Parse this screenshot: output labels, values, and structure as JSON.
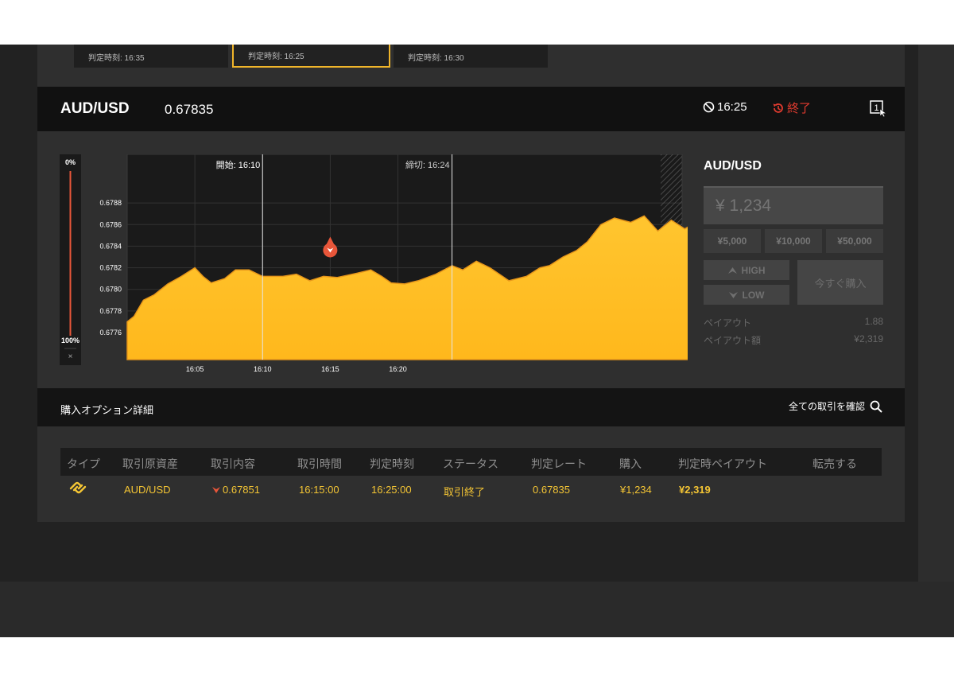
{
  "expiry_cards": [
    {
      "label": "判定時刻: 16:35"
    },
    {
      "label": "判定時刻: 16:25"
    },
    {
      "label": "判定時刻: 16:30"
    }
  ],
  "header": {
    "asset": "AUD/USD",
    "rate": "0.67835",
    "expiry": "16:25",
    "status": "終了",
    "screen_select_number": "1"
  },
  "chart_data": {
    "type": "area",
    "x_ticks": [
      "16:05",
      "16:10",
      "16:15",
      "16:20"
    ],
    "y_ticks": [
      "0.6788",
      "0.6786",
      "0.6784",
      "0.6782",
      "0.6780",
      "0.6778",
      "0.6776"
    ],
    "y_range": [
      0.67735,
      0.67925
    ],
    "x_range_minutes": [
      16.0,
      16.41
    ],
    "start_label": "開始: 16:10",
    "close_label": "締切: 16:24",
    "sentiment_top": "0%",
    "sentiment_bottom": "100%",
    "sentiment_close": "×",
    "entry": {
      "time": "16:15",
      "rate": 0.67851,
      "direction": "low"
    },
    "series": [
      {
        "t": 16.0,
        "v": 0.6777
      },
      {
        "t": 16.005,
        "v": 0.67775
      },
      {
        "t": 16.012,
        "v": 0.6779
      },
      {
        "t": 16.02,
        "v": 0.67795
      },
      {
        "t": 16.03,
        "v": 0.67805
      },
      {
        "t": 16.04,
        "v": 0.67812
      },
      {
        "t": 16.05,
        "v": 0.6782
      },
      {
        "t": 16.056,
        "v": 0.67812
      },
      {
        "t": 16.062,
        "v": 0.67806
      },
      {
        "t": 16.072,
        "v": 0.6781
      },
      {
        "t": 16.08,
        "v": 0.67818
      },
      {
        "t": 16.09,
        "v": 0.67818
      },
      {
        "t": 16.1,
        "v": 0.67812
      },
      {
        "t": 16.115,
        "v": 0.67812
      },
      {
        "t": 16.125,
        "v": 0.67814
      },
      {
        "t": 16.135,
        "v": 0.67808
      },
      {
        "t": 16.145,
        "v": 0.67812
      },
      {
        "t": 16.155,
        "v": 0.67811
      },
      {
        "t": 16.17,
        "v": 0.67815
      },
      {
        "t": 16.18,
        "v": 0.67818
      },
      {
        "t": 16.188,
        "v": 0.67812
      },
      {
        "t": 16.195,
        "v": 0.67806
      },
      {
        "t": 16.205,
        "v": 0.67805
      },
      {
        "t": 16.215,
        "v": 0.67808
      },
      {
        "t": 16.228,
        "v": 0.67814
      },
      {
        "t": 16.24,
        "v": 0.67822
      },
      {
        "t": 16.248,
        "v": 0.67818
      },
      {
        "t": 16.258,
        "v": 0.67826
      },
      {
        "t": 16.268,
        "v": 0.6782
      },
      {
        "t": 16.282,
        "v": 0.67808
      },
      {
        "t": 16.295,
        "v": 0.67812
      },
      {
        "t": 16.305,
        "v": 0.6782
      },
      {
        "t": 16.312,
        "v": 0.67822
      },
      {
        "t": 16.322,
        "v": 0.6783
      },
      {
        "t": 16.332,
        "v": 0.67836
      },
      {
        "t": 16.34,
        "v": 0.67844
      },
      {
        "t": 16.35,
        "v": 0.6786
      },
      {
        "t": 16.36,
        "v": 0.67866
      },
      {
        "t": 16.372,
        "v": 0.67862
      },
      {
        "t": 16.382,
        "v": 0.67868
      },
      {
        "t": 16.392,
        "v": 0.67854
      },
      {
        "t": 16.402,
        "v": 0.67864
      },
      {
        "t": 16.412,
        "v": 0.67856
      },
      {
        "t": 16.42,
        "v": 0.67862
      },
      {
        "t": 16.43,
        "v": 0.67853
      },
      {
        "t": 16.445,
        "v": 0.67856
      },
      {
        "t": 16.458,
        "v": 0.67854
      },
      {
        "t": 16.47,
        "v": 0.67858
      },
      {
        "t": 16.48,
        "v": 0.67867
      },
      {
        "t": 16.492,
        "v": 0.67868
      },
      {
        "t": 16.505,
        "v": 0.67854
      },
      {
        "t": 16.515,
        "v": 0.67842
      },
      {
        "t": 16.522,
        "v": 0.67832
      },
      {
        "t": 16.535,
        "v": 0.67828
      },
      {
        "t": 16.548,
        "v": 0.67828
      },
      {
        "t": 16.56,
        "v": 0.67834
      },
      {
        "t": 16.57,
        "v": 0.67836
      },
      {
        "t": 16.58,
        "v": 0.67833
      },
      {
        "t": 16.592,
        "v": 0.67828
      },
      {
        "t": 16.605,
        "v": 0.67828
      },
      {
        "t": 16.62,
        "v": 0.67831
      },
      {
        "t": 16.632,
        "v": 0.67831
      },
      {
        "t": 16.64,
        "v": 0.67837
      },
      {
        "t": 16.647,
        "v": 0.67833
      }
    ]
  },
  "order_panel": {
    "asset": "AUD/USD",
    "amount_placeholder": "¥ 1,234",
    "presets": [
      "¥5,000",
      "¥10,000",
      "¥50,000"
    ],
    "high_label": "HIGH",
    "low_label": "LOW",
    "buy_now": "今すぐ購入",
    "payout_label": "ペイアウト",
    "payout_value": "1.88",
    "payout_amount_label": "ペイアウト額",
    "payout_amount_value": "¥2,319"
  },
  "details": {
    "title": "購入オプション詳細",
    "link": "全ての取引を確認"
  },
  "table": {
    "headers": [
      "タイプ",
      "取引原資産",
      "取引内容",
      "取引時間",
      "判定時刻",
      "ステータス",
      "判定レート",
      "購入",
      "判定時ペイアウト",
      "転売する"
    ],
    "row": {
      "asset": "AUD/USD",
      "content": "0.67851",
      "trade_time": "16:15:00",
      "judge_time": "16:25:00",
      "status": "取引終了",
      "judge_rate": "0.67835",
      "purchase": "¥1,234",
      "payout": "¥2,319"
    }
  },
  "colors": {
    "accent": "#f0b52a",
    "area_fill": "#ffc52f",
    "down": "#e8563a",
    "status_end": "#e23b2f"
  }
}
